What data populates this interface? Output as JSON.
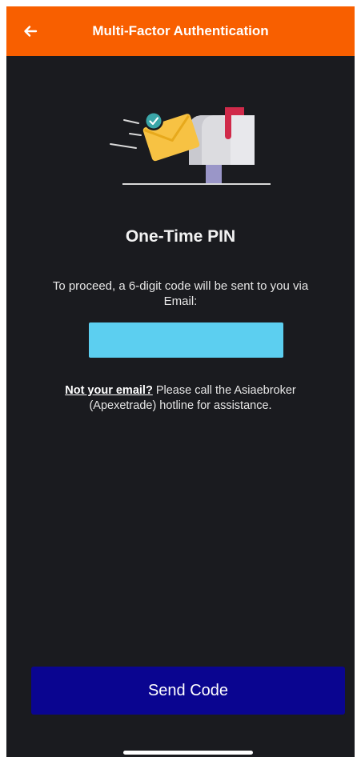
{
  "header": {
    "title": "Multi-Factor Authentication",
    "back_icon": "arrow-left-icon",
    "background": "#f85f00"
  },
  "illustration": {
    "icon": "mailbox-envelope-icon"
  },
  "main": {
    "title": "One-Time PIN",
    "description": "To proceed, a 6-digit code will be sent to you via Email:",
    "email_value": "",
    "note_link": "Not your email?",
    "note_text": " Please call the Asiaebroker (Apexetrade) hotline for assistance."
  },
  "actions": {
    "send_label": "Send Code",
    "send_color": "#0a0590"
  },
  "colors": {
    "background": "#1a1b1f",
    "email_box": "#5ccff0"
  }
}
